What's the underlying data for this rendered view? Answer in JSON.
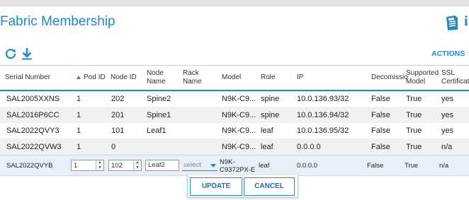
{
  "page": {
    "title": "Fabric Membership",
    "info_glyph": "i",
    "icons": {
      "document": "document-icon",
      "refresh": "refresh-icon",
      "download": "download-icon"
    },
    "actions_label": "ACTIONS",
    "accent_color": "#1f8bc4"
  },
  "table": {
    "columns": {
      "serial": "Serial Number",
      "pod": "Pod ID",
      "node_id": "Node ID",
      "node_name_1": "Node",
      "node_name_2": "Name",
      "rack_name_1": "Rack",
      "rack_name_2": "Name",
      "model": "Model",
      "role": "Role",
      "ip": "IP",
      "decom": "Decomissio",
      "supported_1": "Supported",
      "supported_2": "Model",
      "ssl_1": "SSL",
      "ssl_2": "Certificate"
    },
    "rows": [
      {
        "serial": "SAL2005XXNS",
        "pod": "1",
        "node_id": "202",
        "node_name": "Spine2",
        "rack": "",
        "model": "N9K-C9...",
        "role": "spine",
        "ip": "10.0.136.93/32",
        "decom": "False",
        "supported": "True",
        "ssl": "yes"
      },
      {
        "serial": "SAL2016P6CC",
        "pod": "1",
        "node_id": "201",
        "node_name": "Spine1",
        "rack": "",
        "model": "N9K-C9...",
        "role": "spine",
        "ip": "10.0.136.94/32",
        "decom": "False",
        "supported": "True",
        "ssl": "yes"
      },
      {
        "serial": "SAL2022QVY3",
        "pod": "1",
        "node_id": "101",
        "node_name": "Leaf1",
        "rack": "",
        "model": "N9K-C9...",
        "role": "leaf",
        "ip": "10.0.136.95/32",
        "decom": "False",
        "supported": "True",
        "ssl": "yes"
      },
      {
        "serial": "SAL2022QVW3",
        "pod": "1",
        "node_id": "0",
        "node_name": "",
        "rack": "",
        "model": "N9K-C9...",
        "role": "leaf",
        "ip": "0.0.0.0",
        "decom": "False",
        "supported": "True",
        "ssl": "n/a"
      }
    ],
    "edit_row": {
      "serial": "SAL2022QVYB",
      "pod_value": "1",
      "node_id_value": "102",
      "node_name_value": "Leaf2",
      "rack_select_placeholder": "select",
      "model_line1": "N9K-",
      "model_line2": "C9372PX-E",
      "role": "leaf",
      "ip": "0.0.0.0",
      "decom": "False",
      "supported": "True",
      "ssl": "n/a"
    }
  },
  "buttons": {
    "update": "UPDATE",
    "cancel": "CANCEL"
  }
}
